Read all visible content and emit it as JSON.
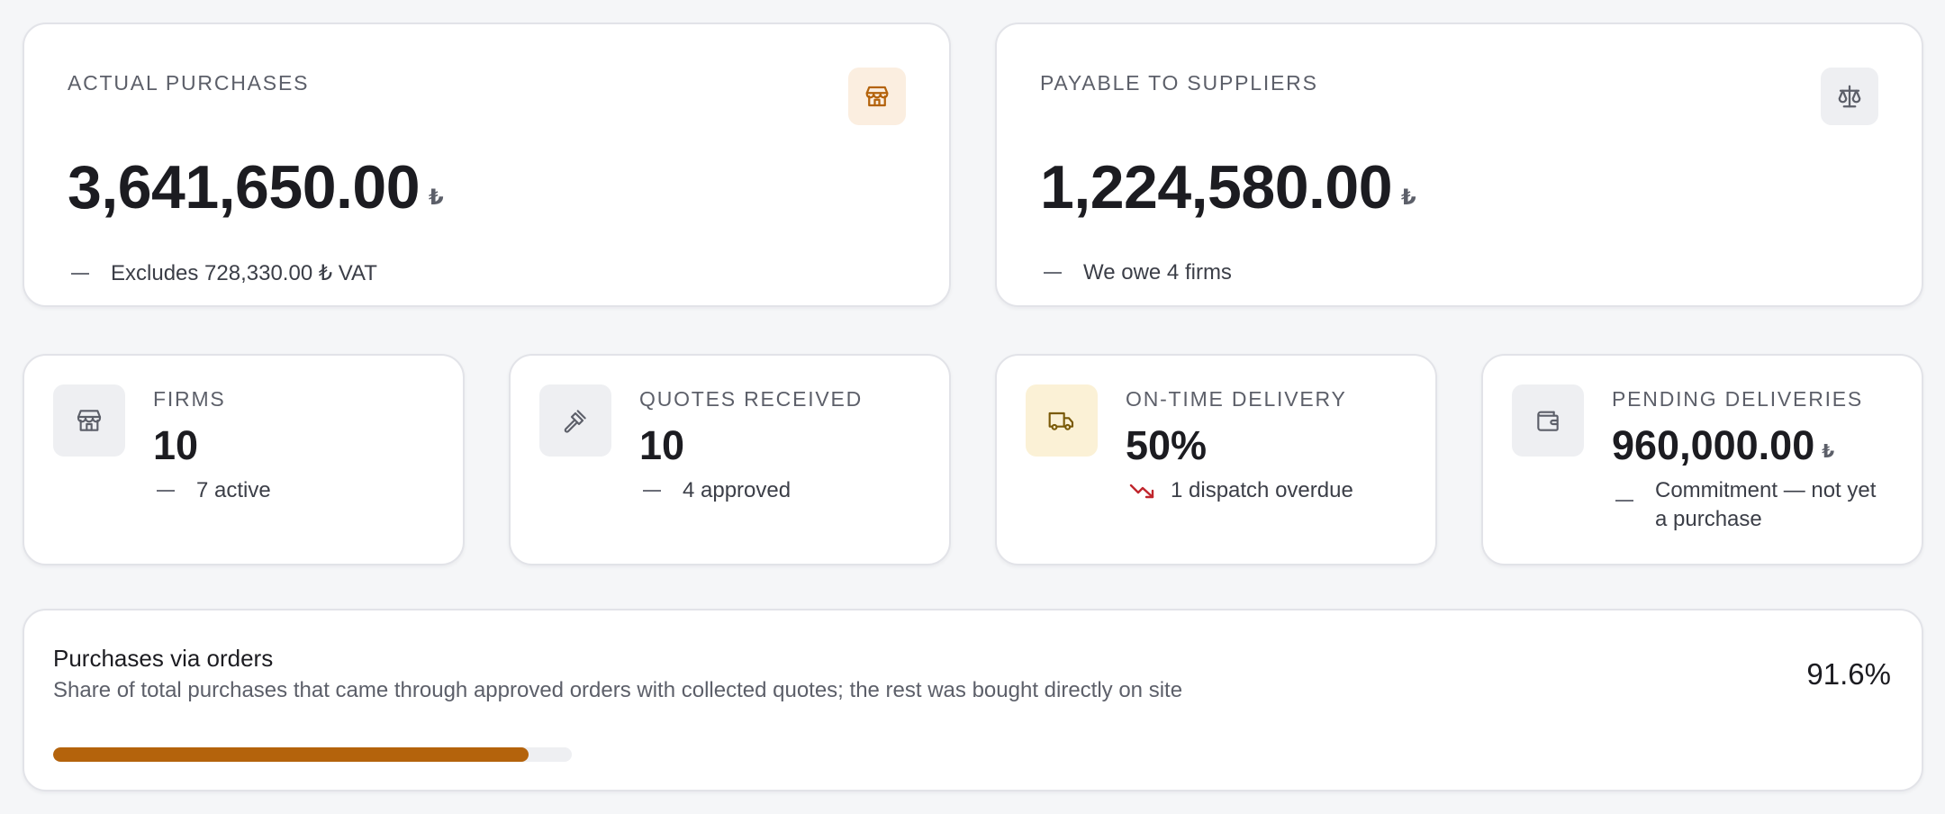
{
  "colors": {
    "accent": "#b4630c",
    "accent_bg": "#fbeee0",
    "neutral_icon_bg": "#eeeff2",
    "warning_bg": "#fbf1d6",
    "trend_down": "#c0262d"
  },
  "actual_purchases": {
    "label": "ACTUAL PURCHASES",
    "icon": "store-icon",
    "value": "3,641,650.00",
    "currency": "₺",
    "sub": "Excludes 728,330.00 ₺ VAT"
  },
  "payable": {
    "label": "PAYABLE TO SUPPLIERS",
    "icon": "scale-icon",
    "value": "1,224,580.00",
    "currency": "₺",
    "sub": "We owe 4 firms"
  },
  "firms": {
    "label": "FIRMS",
    "icon": "store-icon",
    "value": "10",
    "sub": "7 active"
  },
  "quotes": {
    "label": "QUOTES RECEIVED",
    "icon": "gavel-icon",
    "value": "10",
    "sub": "4 approved"
  },
  "on_time": {
    "label": "ON-TIME DELIVERY",
    "icon": "truck-icon",
    "value": "50%",
    "sub": "1 dispatch overdue",
    "trend": "down"
  },
  "pending": {
    "label": "PENDING DELIVERIES",
    "icon": "wallet-icon",
    "value": "960,000.00",
    "currency": "₺",
    "sub": "Commitment — not yet a purchase"
  },
  "orders_share": {
    "title": "Purchases via orders",
    "description": "Share of total purchases that came through approved orders with collected quotes; the rest was bought directly on site",
    "percent_label": "91.6%",
    "percent": 91.6
  }
}
